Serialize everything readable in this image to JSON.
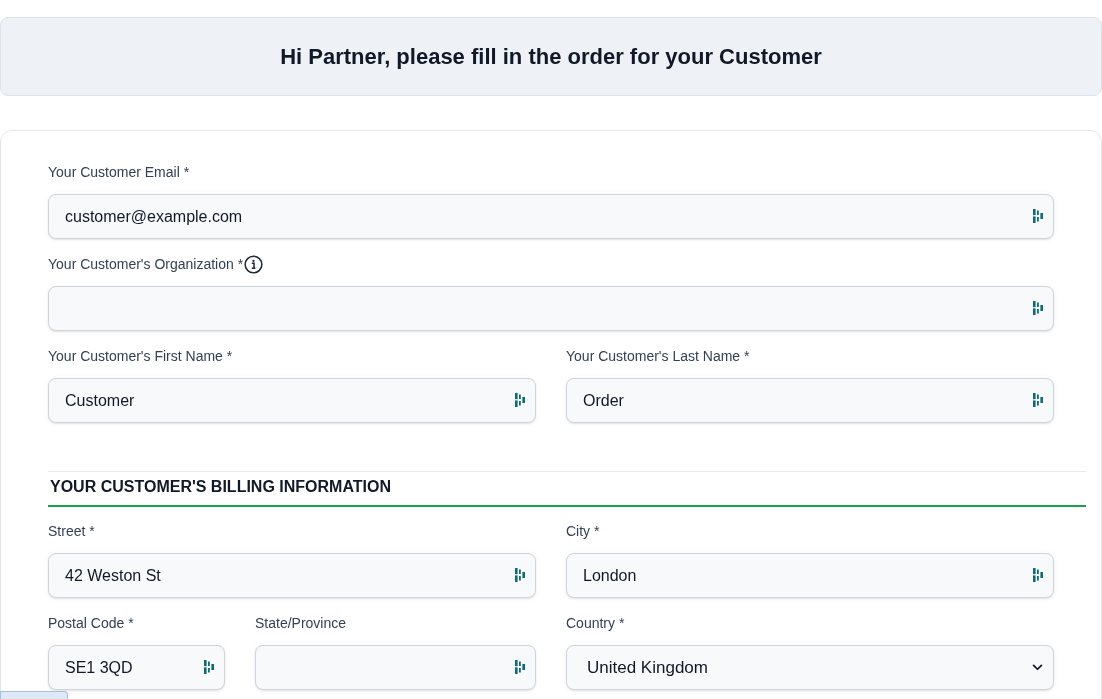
{
  "header": {
    "title": "Hi Partner, please fill in the order for your Customer"
  },
  "sections": [
    {
      "rows": [
        {
          "columns": [
            [
              {
                "kind": "text",
                "label": "Your Customer Email *",
                "value": "customer@example.com",
                "info": false
              }
            ]
          ]
        },
        {
          "columns": [
            [
              {
                "kind": "text",
                "label": "Your Customer's Organization *",
                "info": true
              }
            ]
          ]
        },
        {
          "columns": [
            [
              {
                "kind": "text",
                "label": "Your Customer's First Name *",
                "value": "Customer",
                "info": false
              }
            ],
            [
              {
                "kind": "text",
                "label": "Your Customer's Last Name *",
                "value": "Order",
                "info": false
              }
            ]
          ]
        }
      ]
    },
    {
      "heading": "YOUR CUSTOMER'S BILLING INFORMATION",
      "rows": [
        {
          "columns": [
            [
              {
                "kind": "text",
                "label": "Street *",
                "value": "42 Weston St",
                "info": false
              }
            ],
            [
              {
                "kind": "text",
                "label": "City *",
                "value": "London",
                "info": false
              }
            ]
          ]
        },
        {
          "columns": [
            [
              {
                "kind": "text",
                "label": "Postal Code *",
                "value": "SE1 3QD",
                "info": false
              },
              {
                "kind": "text",
                "label": "State/Province",
                "info": false
              }
            ],
            [
              {
                "kind": "select",
                "label": "Country *",
                "value": "United Kingdom",
                "info": false
              }
            ]
          ]
        }
      ]
    }
  ]
}
